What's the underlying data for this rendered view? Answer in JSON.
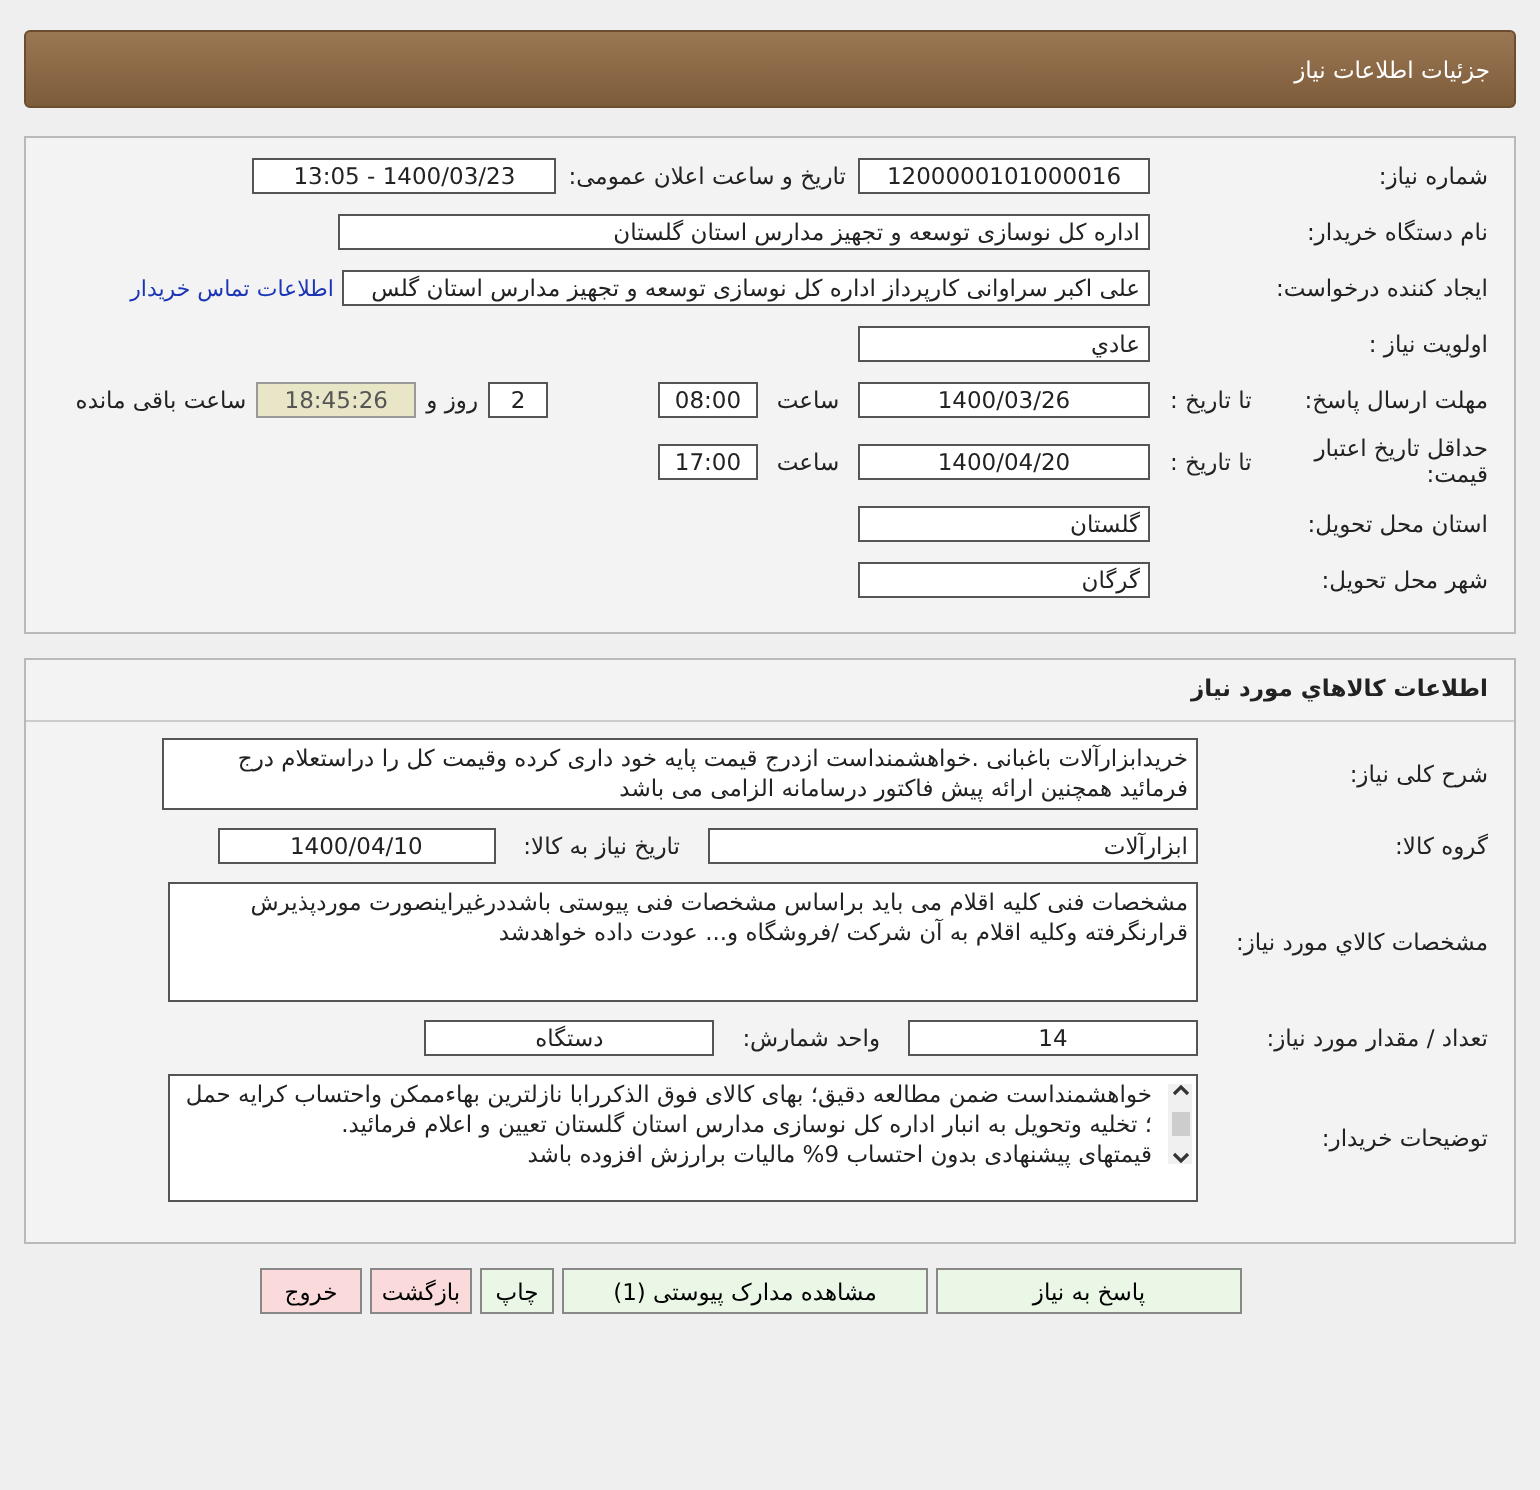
{
  "header": {
    "title": "جزئیات اطلاعات نیاز"
  },
  "need_info": {
    "rows": [
      {
        "label": "شماره نیاز:",
        "parts": [
          {
            "kind": "field",
            "value": "1200000101000016"
          },
          {
            "kind": "text",
            "text": "تاریخ و ساعت اعلان عمومی:"
          },
          {
            "kind": "field",
            "value": "1400/03/23 - 13:05"
          }
        ]
      },
      {
        "label": "نام دستگاه خریدار:",
        "parts": [
          {
            "kind": "field",
            "value": "اداره کل نوسازی  توسعه و تجهیز مدارس استان گلستان"
          }
        ]
      },
      {
        "label": "ایجاد کننده درخواست:",
        "parts": [
          {
            "kind": "field",
            "value": "علی اکبر سراوانی کارپرداز اداره کل نوسازی  توسعه و تجهیز مدارس استان گلس"
          },
          {
            "kind": "link",
            "text": "اطلاعات تماس خریدار"
          }
        ]
      },
      {
        "label": "اولویت نیاز :",
        "parts": [
          {
            "kind": "field",
            "value": "عادي"
          }
        ]
      },
      {
        "label": "مهلت ارسال پاسخ:",
        "sublabel": "تا تاریخ :",
        "parts": [
          {
            "kind": "field",
            "value": "1400/03/26"
          },
          {
            "kind": "text",
            "text": "ساعت"
          },
          {
            "kind": "field",
            "value": "08:00"
          },
          {
            "kind": "field",
            "value": "2"
          },
          {
            "kind": "text",
            "text": "روز و"
          },
          {
            "kind": "timer",
            "value": "18:45:26"
          },
          {
            "kind": "text",
            "text": "ساعت باقی مانده"
          }
        ]
      },
      {
        "label": "حداقل تاریخ اعتبار قیمت:",
        "sublabel": "تا تاریخ :",
        "parts": [
          {
            "kind": "field",
            "value": "1400/04/20"
          },
          {
            "kind": "text",
            "text": "ساعت"
          },
          {
            "kind": "field",
            "value": "17:00"
          }
        ]
      },
      {
        "label": "استان محل تحویل:",
        "parts": [
          {
            "kind": "field",
            "value": "گلستان"
          }
        ]
      },
      {
        "label": "شهر محل تحویل:",
        "parts": [
          {
            "kind": "field",
            "value": "گرگان"
          }
        ]
      }
    ]
  },
  "goods": {
    "title": "اطلاعات کالاهاي مورد نیاز",
    "rows": [
      {
        "label": "شرح کلی نیاز:",
        "parts": [
          {
            "kind": "box",
            "lines": [
              "خریدابزارآلات باغبانی .خواهشمنداست ازدرج قیمت پایه خود داری کرده وقیمت کل را دراستعلام درج فرمائید همچنین ارائه پیش فاکتور درسامانه الزامی می باشد"
            ]
          }
        ]
      },
      {
        "label": "گروه کالا:",
        "parts": [
          {
            "kind": "field",
            "value": "ابزارآلات"
          },
          {
            "kind": "text",
            "text": "تاریخ نیاز به کالا:"
          },
          {
            "kind": "field",
            "value": "1400/04/10"
          }
        ]
      },
      {
        "label": "مشخصات کالاي مورد نیاز:",
        "parts": [
          {
            "kind": "box",
            "lines": [
              "مشخصات فنی کلیه اقلام می باید براساس مشخصات فنی پیوستی باشددرغیراینصورت موردپذیرش قرارنگرفته وکلیه اقلام به آن شرکت /فروشگاه و... عودت داده خواهدشد"
            ]
          }
        ]
      },
      {
        "label": "تعداد / مقدار مورد نیاز:",
        "parts": [
          {
            "kind": "field",
            "value": "14"
          },
          {
            "kind": "text",
            "text": "واحد شمارش:"
          },
          {
            "kind": "field",
            "value": "دستگاه"
          }
        ]
      },
      {
        "label": "توضیحات خریدار:",
        "parts": [
          {
            "kind": "scrollbox",
            "lines": [
              "خواهشمنداست ضمن مطالعه دقیق؛ بهای کالای فوق الذکررابا نازلترین بهاءممکن واحتساب کرایه حمل ؛ تخلیه وتحویل به انبار اداره کل نوسازی مدارس استان گلستان تعیین و اعلام فرمائید.",
              "قیمتهای پیشنهادی بدون احتساب 9% مالیات برارزش افزوده باشد"
            ]
          }
        ]
      }
    ]
  },
  "buttons": [
    {
      "label": "پاسخ به نیاز",
      "kind": "confirm"
    },
    {
      "label": "مشاهده مدارک پیوستی (1)",
      "kind": "confirm"
    },
    {
      "label": "چاپ",
      "kind": "confirm"
    },
    {
      "label": "بازگشت",
      "kind": "cancel"
    },
    {
      "label": "خروج",
      "kind": "cancel"
    }
  ]
}
